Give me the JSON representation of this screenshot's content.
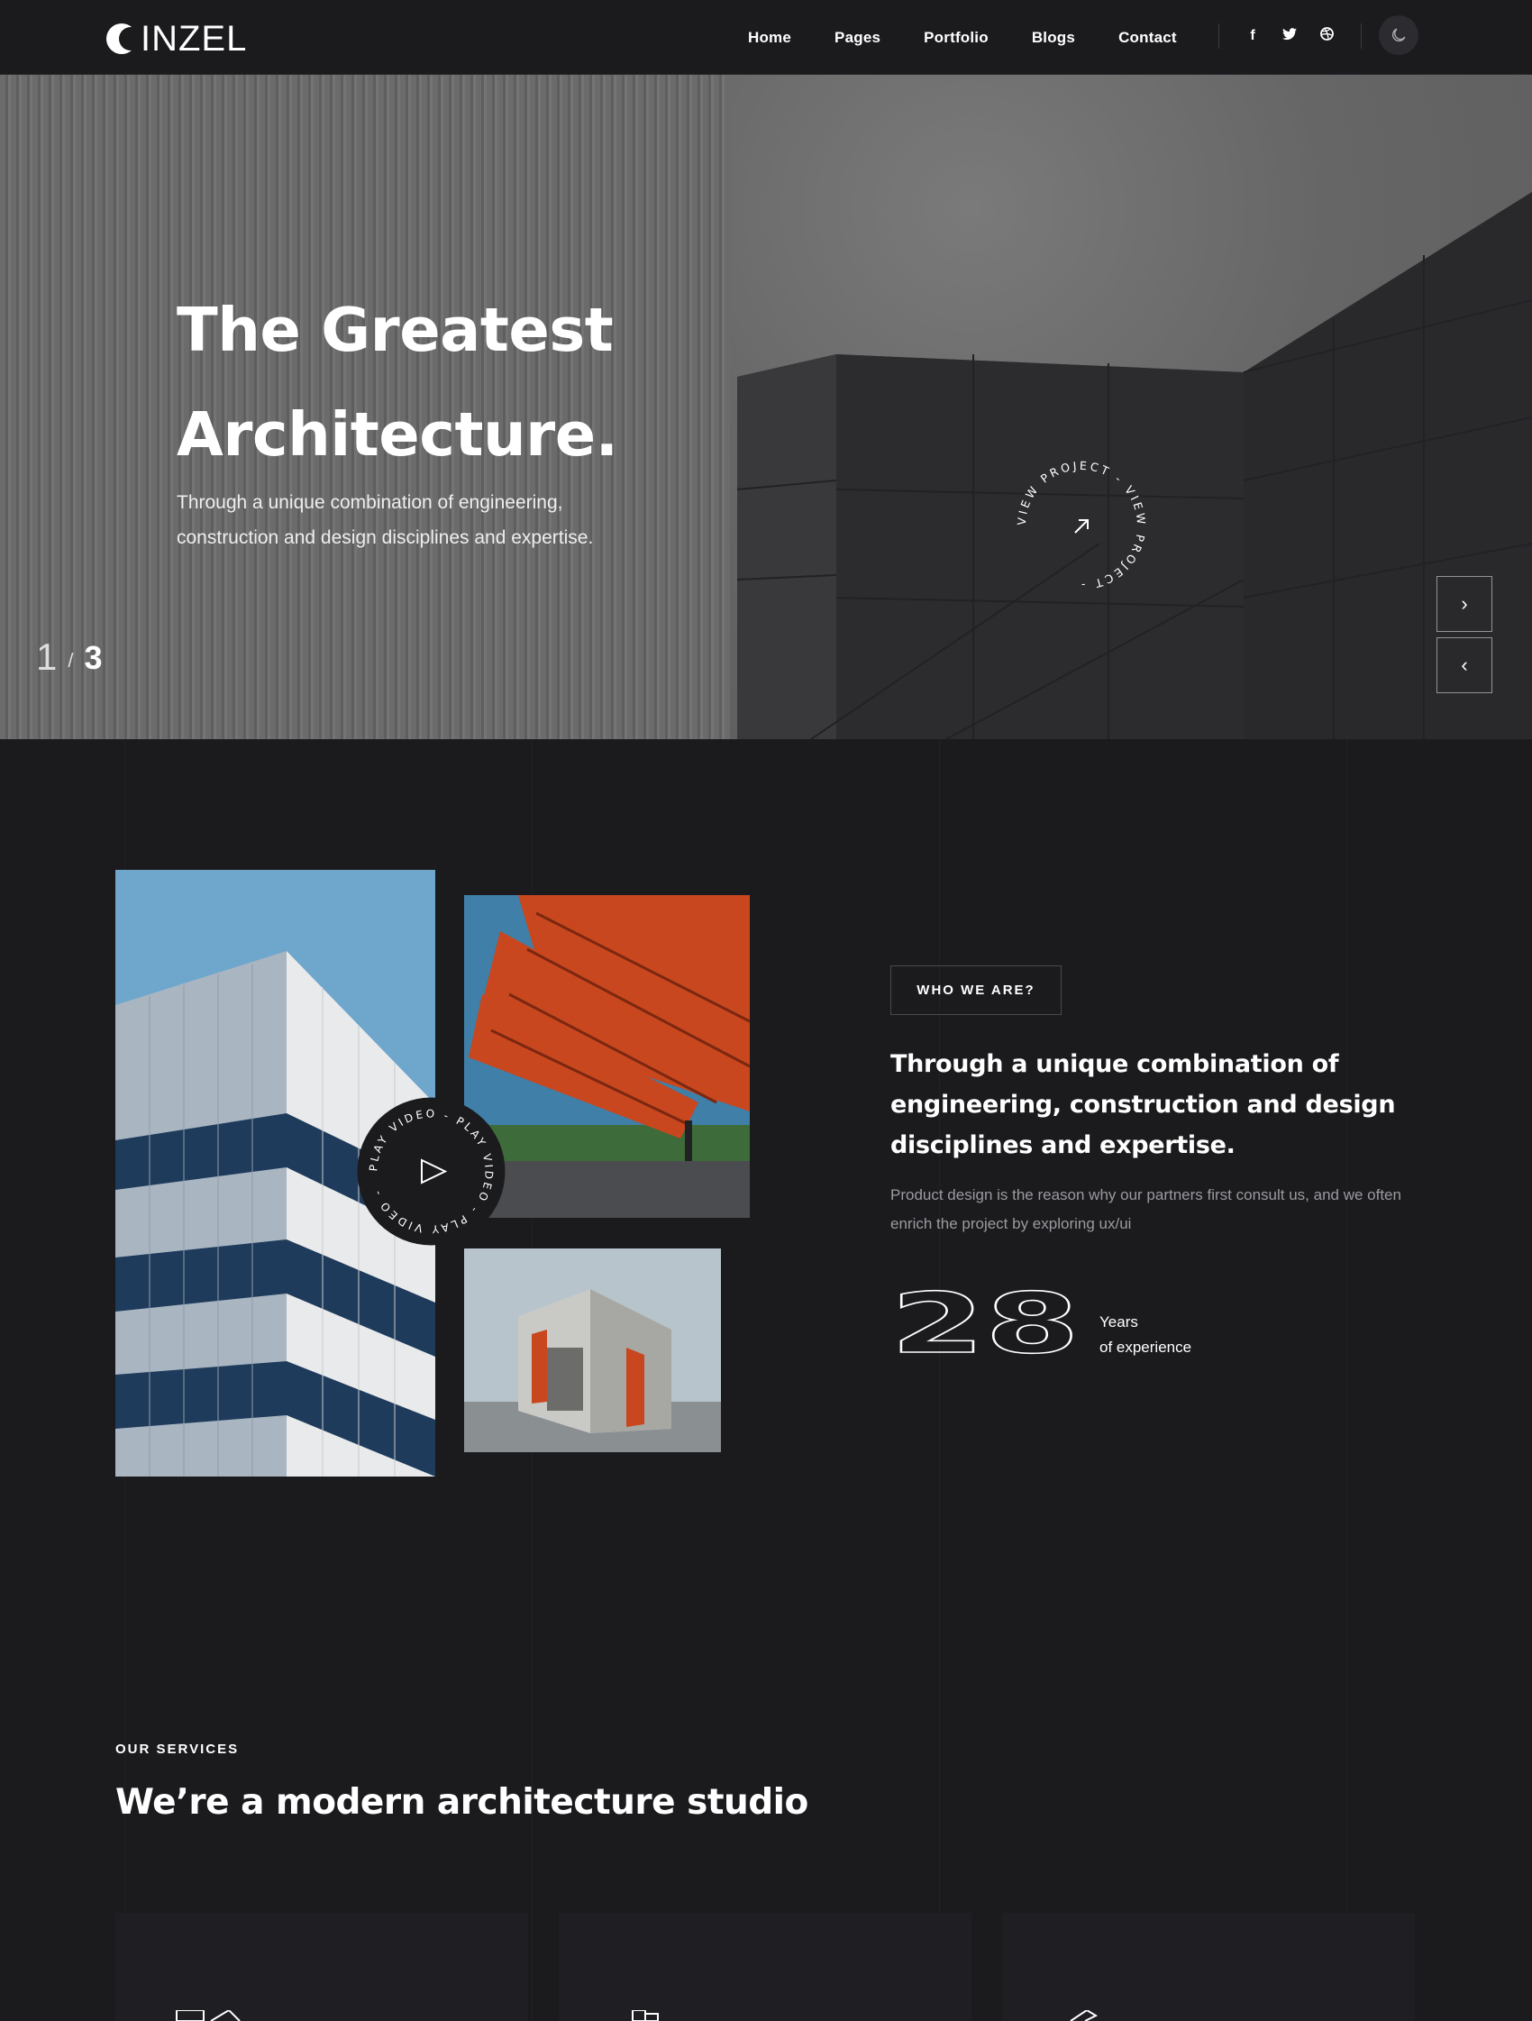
{
  "brand": {
    "logo_text": "INZEL"
  },
  "nav": {
    "items": [
      "Home",
      "Pages",
      "Portfolio",
      "Blogs",
      "Contact"
    ],
    "social": [
      "f",
      "twitter-icon",
      "dribbble-icon"
    ],
    "theme_toggle": "moon-icon"
  },
  "hero": {
    "title_line1": "The Greatest",
    "title_line2": "Architecture.",
    "subtitle_line1": "Through a unique combination of engineering,",
    "subtitle_line2": "construction and design disciplines and expertise.",
    "slide_current": "1",
    "slide_separator": "/",
    "slide_total": "3",
    "view_badge_text": "VIEW PROJECT - VIEW PROJECT -",
    "next_label": "›",
    "prev_label": "‹"
  },
  "about": {
    "tag": "WHO WE ARE?",
    "heading": "Through a unique combination of engineering, construction and design disciplines and expertise.",
    "paragraph": "Product design is the reason why our partners first consult us, and we often enrich the project by exploring ux/ui",
    "play_badge_text": "PLAY VIDEO - PLAY VIDEO - PLAY VIDEO -",
    "years_number": "28",
    "years_label_line1": "Years",
    "years_label_line2": "of experience"
  },
  "services": {
    "kicker": "OUR SERVICES",
    "title": "We’re a modern architecture studio"
  },
  "colors": {
    "background": "#1b1b1e",
    "accent_orange": "#c8471f",
    "text": "#ffffff",
    "muted": "#9a9aa0"
  }
}
